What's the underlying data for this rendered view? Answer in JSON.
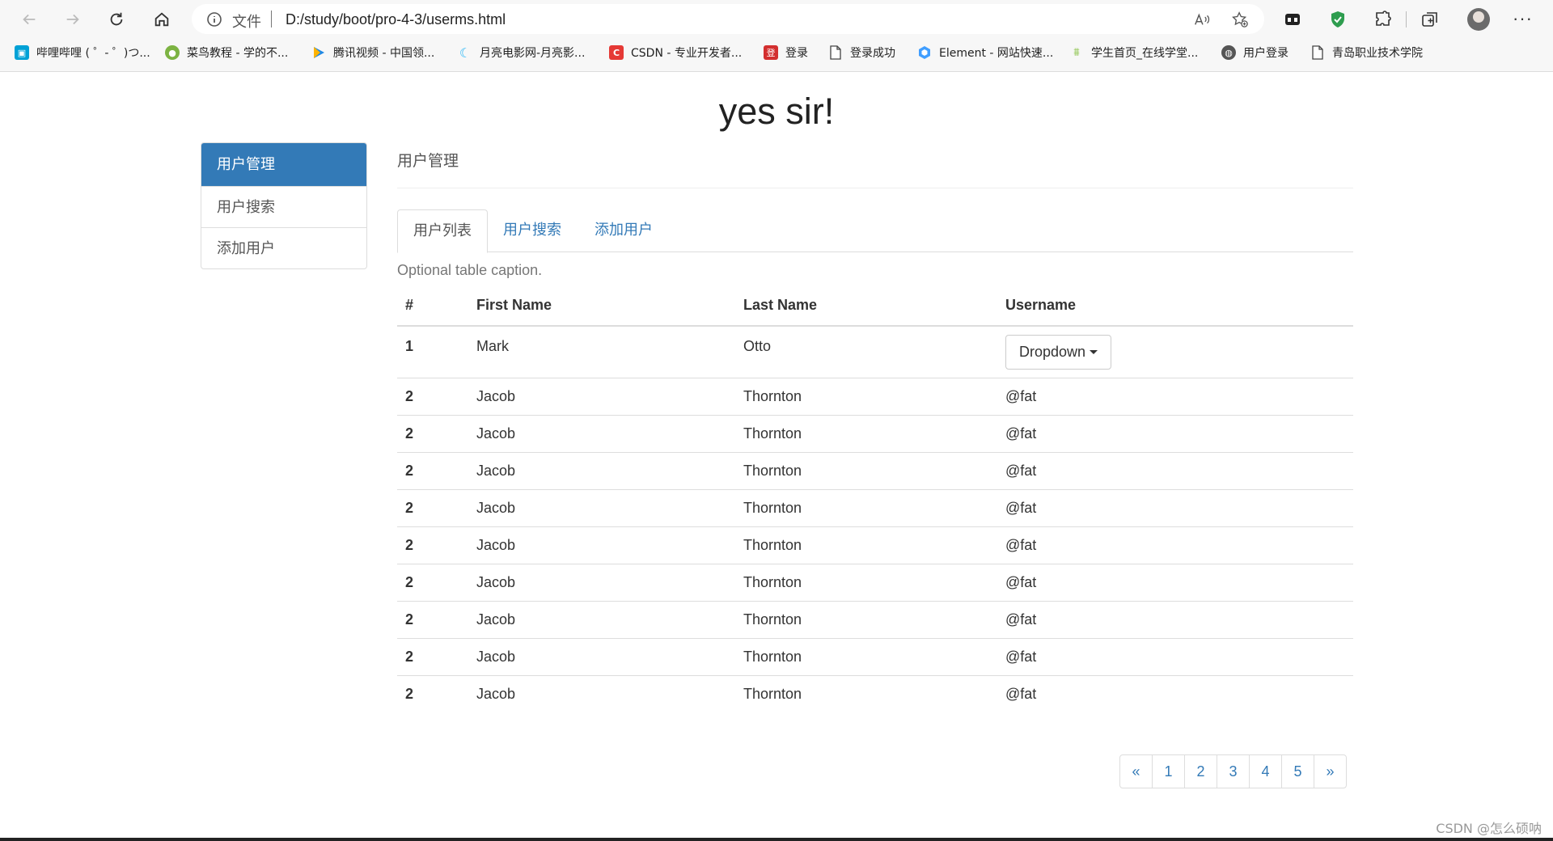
{
  "browser": {
    "address": {
      "file_label": "文件",
      "url": "D:/study/boot/pro-4-3/userms.html"
    },
    "bookmarks": [
      {
        "label": "哔哩哔哩 ( ゜- ゜)つ...",
        "icon": "bilibili-icon",
        "color": "#00a1d6"
      },
      {
        "label": "菜鸟教程 - 学的不...",
        "icon": "runoob-icon",
        "color": "#7cb342"
      },
      {
        "label": "腾讯视频 - 中国领...",
        "icon": "tencent-video-icon",
        "color": "#1e88e5"
      },
      {
        "label": "月亮电影网-月亮影...",
        "icon": "moon-movie-icon",
        "color": "#29b6f6"
      },
      {
        "label": "CSDN - 专业开发者...",
        "icon": "csdn-icon",
        "color": "#e53935"
      },
      {
        "label": "登录",
        "icon": "login-red-icon",
        "color": "#d32f2f"
      },
      {
        "label": "登录成功",
        "icon": "page-icon",
        "color": "#ffffff"
      },
      {
        "label": "Element - 网站快速...",
        "icon": "element-icon",
        "color": "#409eff"
      },
      {
        "label": "学生首页_在线学堂...",
        "icon": "study-icon",
        "color": "#8bc34a"
      },
      {
        "label": "用户登录",
        "icon": "globe-icon",
        "color": "#555555"
      },
      {
        "label": "青岛职业技术学院",
        "icon": "page-icon",
        "color": "#ffffff"
      }
    ]
  },
  "page": {
    "title": "yes sir!",
    "section_title": "用户管理",
    "caption": "Optional table caption."
  },
  "sidebar": {
    "items": [
      {
        "label": "用户管理",
        "active": true
      },
      {
        "label": "用户搜索",
        "active": false
      },
      {
        "label": "添加用户",
        "active": false
      }
    ]
  },
  "tabs": [
    {
      "label": "用户列表",
      "active": true
    },
    {
      "label": "用户搜索",
      "active": false
    },
    {
      "label": "添加用户",
      "active": false
    }
  ],
  "table": {
    "headers": [
      "#",
      "First Name",
      "Last Name",
      "Username"
    ],
    "first_row": {
      "idx": "1",
      "first": "Mark",
      "last": "Otto",
      "dropdown_label": "Dropdown"
    },
    "rows": [
      {
        "idx": "2",
        "first": "Jacob",
        "last": "Thornton",
        "user": "@fat"
      },
      {
        "idx": "2",
        "first": "Jacob",
        "last": "Thornton",
        "user": "@fat"
      },
      {
        "idx": "2",
        "first": "Jacob",
        "last": "Thornton",
        "user": "@fat"
      },
      {
        "idx": "2",
        "first": "Jacob",
        "last": "Thornton",
        "user": "@fat"
      },
      {
        "idx": "2",
        "first": "Jacob",
        "last": "Thornton",
        "user": "@fat"
      },
      {
        "idx": "2",
        "first": "Jacob",
        "last": "Thornton",
        "user": "@fat"
      },
      {
        "idx": "2",
        "first": "Jacob",
        "last": "Thornton",
        "user": "@fat"
      },
      {
        "idx": "2",
        "first": "Jacob",
        "last": "Thornton",
        "user": "@fat"
      },
      {
        "idx": "2",
        "first": "Jacob",
        "last": "Thornton",
        "user": "@fat"
      }
    ]
  },
  "pagination": [
    "«",
    "1",
    "2",
    "3",
    "4",
    "5",
    "»"
  ],
  "watermark": "CSDN @怎么硕呐",
  "colors": {
    "primary": "#337ab7",
    "border": "#dddddd",
    "text": "#333333",
    "muted": "#777777"
  }
}
